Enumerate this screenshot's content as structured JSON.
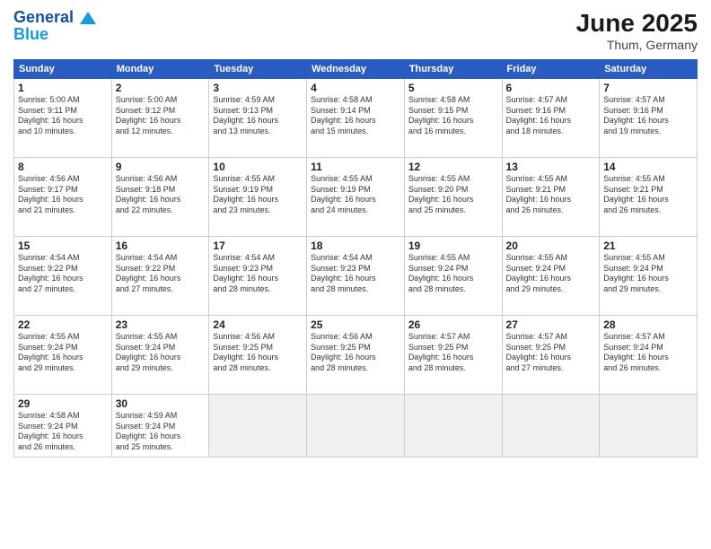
{
  "header": {
    "logo_line1": "General",
    "logo_line2": "Blue",
    "month": "June 2025",
    "location": "Thum, Germany"
  },
  "weekdays": [
    "Sunday",
    "Monday",
    "Tuesday",
    "Wednesday",
    "Thursday",
    "Friday",
    "Saturday"
  ],
  "weeks": [
    [
      {
        "day": "1",
        "info": "Sunrise: 5:00 AM\nSunset: 9:11 PM\nDaylight: 16 hours\nand 10 minutes."
      },
      {
        "day": "2",
        "info": "Sunrise: 5:00 AM\nSunset: 9:12 PM\nDaylight: 16 hours\nand 12 minutes."
      },
      {
        "day": "3",
        "info": "Sunrise: 4:59 AM\nSunset: 9:13 PM\nDaylight: 16 hours\nand 13 minutes."
      },
      {
        "day": "4",
        "info": "Sunrise: 4:58 AM\nSunset: 9:14 PM\nDaylight: 16 hours\nand 15 minutes."
      },
      {
        "day": "5",
        "info": "Sunrise: 4:58 AM\nSunset: 9:15 PM\nDaylight: 16 hours\nand 16 minutes."
      },
      {
        "day": "6",
        "info": "Sunrise: 4:57 AM\nSunset: 9:16 PM\nDaylight: 16 hours\nand 18 minutes."
      },
      {
        "day": "7",
        "info": "Sunrise: 4:57 AM\nSunset: 9:16 PM\nDaylight: 16 hours\nand 19 minutes."
      }
    ],
    [
      {
        "day": "8",
        "info": "Sunrise: 4:56 AM\nSunset: 9:17 PM\nDaylight: 16 hours\nand 21 minutes."
      },
      {
        "day": "9",
        "info": "Sunrise: 4:56 AM\nSunset: 9:18 PM\nDaylight: 16 hours\nand 22 minutes."
      },
      {
        "day": "10",
        "info": "Sunrise: 4:55 AM\nSunset: 9:19 PM\nDaylight: 16 hours\nand 23 minutes."
      },
      {
        "day": "11",
        "info": "Sunrise: 4:55 AM\nSunset: 9:19 PM\nDaylight: 16 hours\nand 24 minutes."
      },
      {
        "day": "12",
        "info": "Sunrise: 4:55 AM\nSunset: 9:20 PM\nDaylight: 16 hours\nand 25 minutes."
      },
      {
        "day": "13",
        "info": "Sunrise: 4:55 AM\nSunset: 9:21 PM\nDaylight: 16 hours\nand 26 minutes."
      },
      {
        "day": "14",
        "info": "Sunrise: 4:55 AM\nSunset: 9:21 PM\nDaylight: 16 hours\nand 26 minutes."
      }
    ],
    [
      {
        "day": "15",
        "info": "Sunrise: 4:54 AM\nSunset: 9:22 PM\nDaylight: 16 hours\nand 27 minutes."
      },
      {
        "day": "16",
        "info": "Sunrise: 4:54 AM\nSunset: 9:22 PM\nDaylight: 16 hours\nand 27 minutes."
      },
      {
        "day": "17",
        "info": "Sunrise: 4:54 AM\nSunset: 9:23 PM\nDaylight: 16 hours\nand 28 minutes."
      },
      {
        "day": "18",
        "info": "Sunrise: 4:54 AM\nSunset: 9:23 PM\nDaylight: 16 hours\nand 28 minutes."
      },
      {
        "day": "19",
        "info": "Sunrise: 4:55 AM\nSunset: 9:24 PM\nDaylight: 16 hours\nand 28 minutes."
      },
      {
        "day": "20",
        "info": "Sunrise: 4:55 AM\nSunset: 9:24 PM\nDaylight: 16 hours\nand 29 minutes."
      },
      {
        "day": "21",
        "info": "Sunrise: 4:55 AM\nSunset: 9:24 PM\nDaylight: 16 hours\nand 29 minutes."
      }
    ],
    [
      {
        "day": "22",
        "info": "Sunrise: 4:55 AM\nSunset: 9:24 PM\nDaylight: 16 hours\nand 29 minutes."
      },
      {
        "day": "23",
        "info": "Sunrise: 4:55 AM\nSunset: 9:24 PM\nDaylight: 16 hours\nand 29 minutes."
      },
      {
        "day": "24",
        "info": "Sunrise: 4:56 AM\nSunset: 9:25 PM\nDaylight: 16 hours\nand 28 minutes."
      },
      {
        "day": "25",
        "info": "Sunrise: 4:56 AM\nSunset: 9:25 PM\nDaylight: 16 hours\nand 28 minutes."
      },
      {
        "day": "26",
        "info": "Sunrise: 4:57 AM\nSunset: 9:25 PM\nDaylight: 16 hours\nand 28 minutes."
      },
      {
        "day": "27",
        "info": "Sunrise: 4:57 AM\nSunset: 9:25 PM\nDaylight: 16 hours\nand 27 minutes."
      },
      {
        "day": "28",
        "info": "Sunrise: 4:57 AM\nSunset: 9:24 PM\nDaylight: 16 hours\nand 26 minutes."
      }
    ],
    [
      {
        "day": "29",
        "info": "Sunrise: 4:58 AM\nSunset: 9:24 PM\nDaylight: 16 hours\nand 26 minutes."
      },
      {
        "day": "30",
        "info": "Sunrise: 4:59 AM\nSunset: 9:24 PM\nDaylight: 16 hours\nand 25 minutes."
      },
      {
        "day": "",
        "info": ""
      },
      {
        "day": "",
        "info": ""
      },
      {
        "day": "",
        "info": ""
      },
      {
        "day": "",
        "info": ""
      },
      {
        "day": "",
        "info": ""
      }
    ]
  ]
}
